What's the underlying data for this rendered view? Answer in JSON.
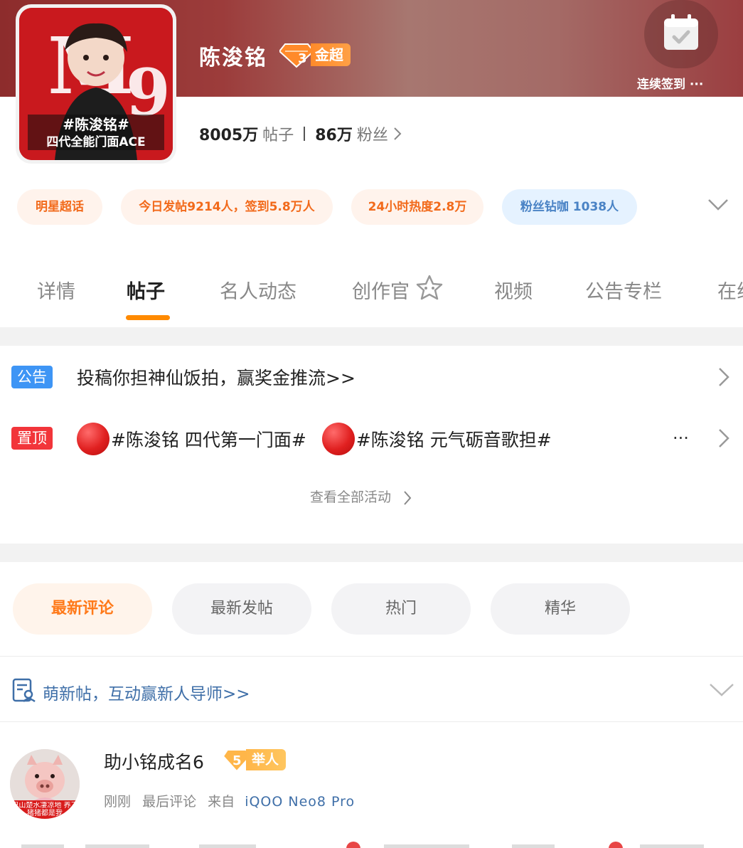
{
  "header": {
    "name": "陈浚铭",
    "level": "3",
    "level_label": "金超",
    "checkin_label": "连续签到 ···",
    "cover_text_line1": "#陈浚铭#",
    "cover_text_line2": "四代全能门面ACE"
  },
  "stats": {
    "posts_num": "8005万",
    "posts_unit": "帖子",
    "fans_num": "86万",
    "fans_unit": "粉丝"
  },
  "tags": [
    "明星超话",
    "今日发帖9214人，签到5.8万人",
    "24小时热度2.8万",
    "粉丝钻咖  1038人"
  ],
  "tabs": [
    "详情",
    "帖子",
    "名人动态",
    "创作官",
    "视频",
    "公告专栏",
    "在线"
  ],
  "notices": {
    "announce_tag": "公告",
    "announce_text": "投稿你担神仙饭拍，赢奖金推流>>",
    "pinned_tag": "置顶",
    "pinned_items": [
      "#陈浚铭  四代第一门面#",
      "#陈浚铭  元气砺音歌担#"
    ],
    "more": "···",
    "view_all": "查看全部活动"
  },
  "sort_chips": [
    "最新评论",
    "最新发帖",
    "热门",
    "精华"
  ],
  "promo": {
    "text": "萌新帖，互动赢新人导师>>"
  },
  "post": {
    "username": "助小铭成名6",
    "user_level": "5",
    "user_badge": "举人",
    "time": "刚刚",
    "action": "最后评论",
    "from_label": "来自",
    "device": "iQOO  Neo8  Pro",
    "avatar_caption": "巴山楚水凄凉地 养了猪猪都是我"
  },
  "colors": {
    "accent": "#ff8a00",
    "tag_orange": "#f26a1b",
    "tag_blue": "#4a83c5",
    "announce_blue": "#3e95f5",
    "pinned_red": "#f2353a",
    "link_blue": "#3f6fa8"
  },
  "icons": [
    "checkin-calendar-icon",
    "chevron-right-icon",
    "chevron-down-icon",
    "creator-star-icon",
    "new-post-guide-icon"
  ]
}
